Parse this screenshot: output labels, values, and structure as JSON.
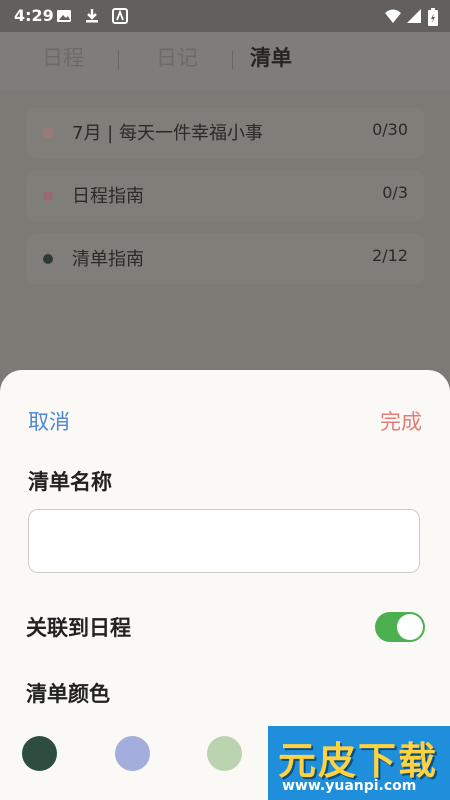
{
  "status_bar": {
    "time": "4:29",
    "icons": [
      "image-icon",
      "download-icon",
      "app-icon",
      "wifi-icon",
      "signal-icon",
      "battery-icon"
    ]
  },
  "tabs": [
    {
      "label": "日程",
      "active": false
    },
    {
      "label": "日记",
      "active": false
    },
    {
      "label": "清单",
      "active": true
    }
  ],
  "lists": [
    {
      "label": "7月 | 每天一件幸福小事",
      "count": "0/30",
      "dot_color": "#9a7a78",
      "dot_shape": "square"
    },
    {
      "label": "日程指南",
      "count": "0/3",
      "dot_color": "#9a6a70",
      "dot_shape": "circle"
    },
    {
      "label": "清单指南",
      "count": "2/12",
      "dot_color": "#2c3b33",
      "dot_shape": "circle"
    }
  ],
  "sheet": {
    "cancel_label": "取消",
    "done_label": "完成",
    "name_heading": "清单名称",
    "name_value": "",
    "link_heading": "关联到日程",
    "link_enabled": true,
    "color_heading": "清单颜色",
    "colors": [
      "#2e4d3f",
      "#a3aedc",
      "#bcd3b0"
    ]
  },
  "watermark": {
    "text": "元皮下载",
    "url": "www.yuanpi.com"
  },
  "theme": {
    "accent_blue": "#4c86d6",
    "accent_red": "#e57c78",
    "toggle_green": "#4caf50"
  }
}
